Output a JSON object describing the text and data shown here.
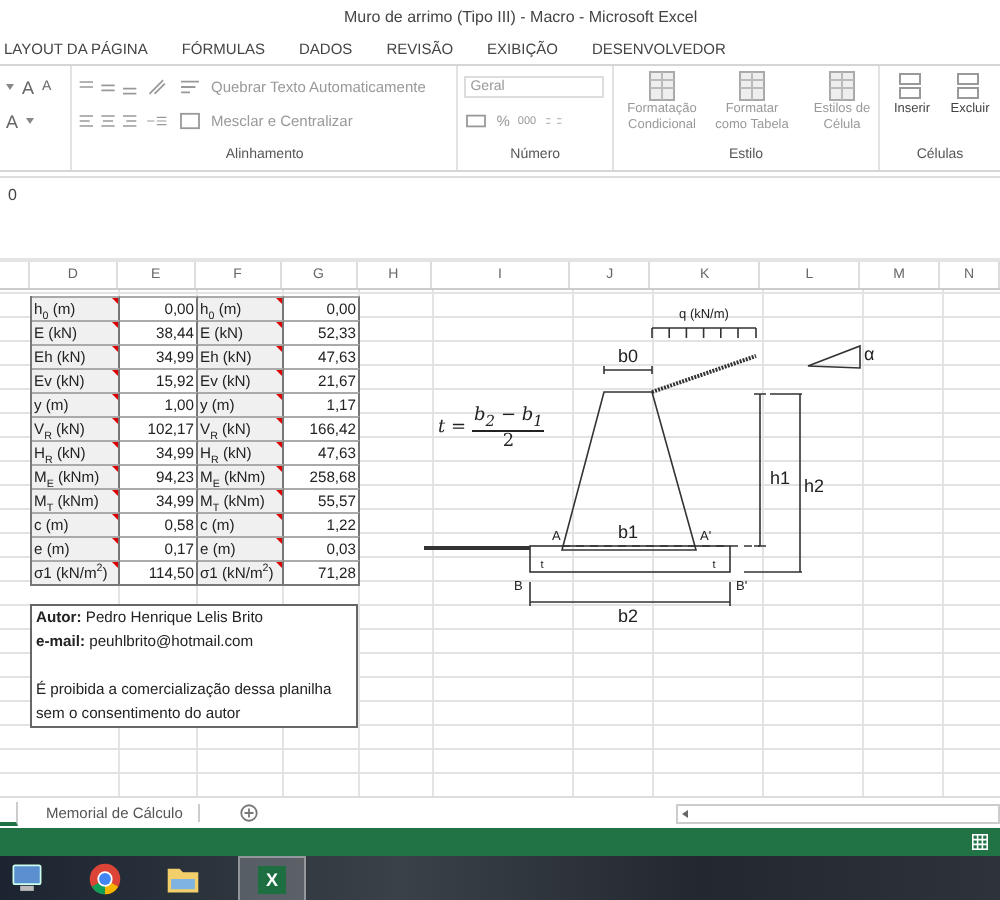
{
  "window": {
    "title": "Muro de arrimo (Tipo III) - Macro - Microsoft Excel"
  },
  "menu_tabs": [
    {
      "label": "LAYOUT DA PÁGINA"
    },
    {
      "label": "FÓRMULAS"
    },
    {
      "label": "DADOS"
    },
    {
      "label": "REVISÃO"
    },
    {
      "label": "EXIBIÇÃO"
    },
    {
      "label": "DESENVOLVEDOR"
    }
  ],
  "ribbon": {
    "font": {
      "grow": "A",
      "shrink": "A",
      "text_tint": "A"
    },
    "alignment": {
      "wrap_text": "Quebrar Texto Automaticamente",
      "merge": "Mesclar e Centralizar",
      "label": "Alinhamento"
    },
    "number": {
      "format": "Geral",
      "percent": "%",
      "thousands": "000",
      "label": "Número"
    },
    "styles": {
      "buttons": [
        "Formatação Condicional",
        "Formatar como Tabela",
        "Estilos de Célula"
      ],
      "label": "Estilo"
    },
    "cells": {
      "buttons": [
        "Inserir",
        "Excluir"
      ],
      "label": "Células"
    }
  },
  "formula_bar": {
    "value": "0"
  },
  "columns": [
    "D",
    "E",
    "F",
    "G",
    "H",
    "I",
    "J",
    "K",
    "L",
    "M",
    "N"
  ],
  "table": {
    "rows": [
      {
        "label_1": "h$_{0}$ (m)",
        "value_1": "0,00",
        "label_2": "h$_{0}$ (m)",
        "value_2": "0,00"
      },
      {
        "label_1": "E (kN)",
        "value_1": "38,44",
        "label_2": "E (kN)",
        "value_2": "52,33"
      },
      {
        "label_1": "Eh (kN)",
        "value_1": "34,99",
        "label_2": "Eh (kN)",
        "value_2": "47,63"
      },
      {
        "label_1": "Ev (kN)",
        "value_1": "15,92",
        "label_2": "Ev (kN)",
        "value_2": "21,67"
      },
      {
        "label_1": "y (m)",
        "value_1": "1,00",
        "label_2": "y (m)",
        "value_2": "1,17"
      },
      {
        "label_1": "V$_{R}$ (kN)",
        "value_1": "102,17",
        "label_2": "V$_{R}$ (kN)",
        "value_2": "166,42"
      },
      {
        "label_1": "H$_{R}$ (kN)",
        "value_1": "34,99",
        "label_2": "H$_{R}$ (kN)",
        "value_2": "47,63"
      },
      {
        "label_1": "M$_{E}$ (kNm)",
        "value_1": "94,23",
        "label_2": "M$_{E}$ (kNm)",
        "value_2": "258,68"
      },
      {
        "label_1": "M$_{T}$ (kNm)",
        "value_1": "34,99",
        "label_2": "M$_{T}$ (kNm)",
        "value_2": "55,57"
      },
      {
        "label_1": "c (m)",
        "value_1": "0,58",
        "label_2": "c (m)",
        "value_2": "1,22"
      },
      {
        "label_1": "e (m)",
        "value_1": "0,17",
        "label_2": "e (m)",
        "value_2": "0,03"
      },
      {
        "label_1": "σ1 (kN/m$^{2}$)",
        "value_1": "114,50",
        "label_2": "σ1 (kN/m$^{2}$)",
        "value_2": "71,28"
      }
    ]
  },
  "author_note": {
    "lines": [
      "**Autor:** Pedro Henrique Lelis Brito",
      "**e-mail:** peuhlbrito@hotmail.com"
    ],
    "notice": [
      "É proibida a comercialização dessa planilha",
      "sem o consentimento do autor"
    ]
  },
  "diagram": {
    "load": "q (kN/m)",
    "top_width": "b0",
    "angle": "α",
    "height_1": "h1",
    "height_2": "h2",
    "inner_width": "b1",
    "point_a": "A",
    "point_a2": "A'",
    "point_b": "B",
    "point_b2": "B'",
    "base_width": "b2",
    "toe_left": "t",
    "toe_right": "t",
    "formula": {
      "lhs": "t =",
      "numerator": "b$_{2}$ − b$_{1}$",
      "denominator": "2"
    }
  },
  "sheet_tabs": [
    {
      "label": "Memorial de Cálculo",
      "selected": false
    }
  ],
  "taskbar": {
    "apps": [
      {
        "kind": "computer",
        "active": false
      },
      {
        "kind": "browser",
        "active": false
      },
      {
        "kind": "folder",
        "active": false
      },
      {
        "kind": "spreadsheet",
        "active": true,
        "letter": "X"
      }
    ]
  }
}
